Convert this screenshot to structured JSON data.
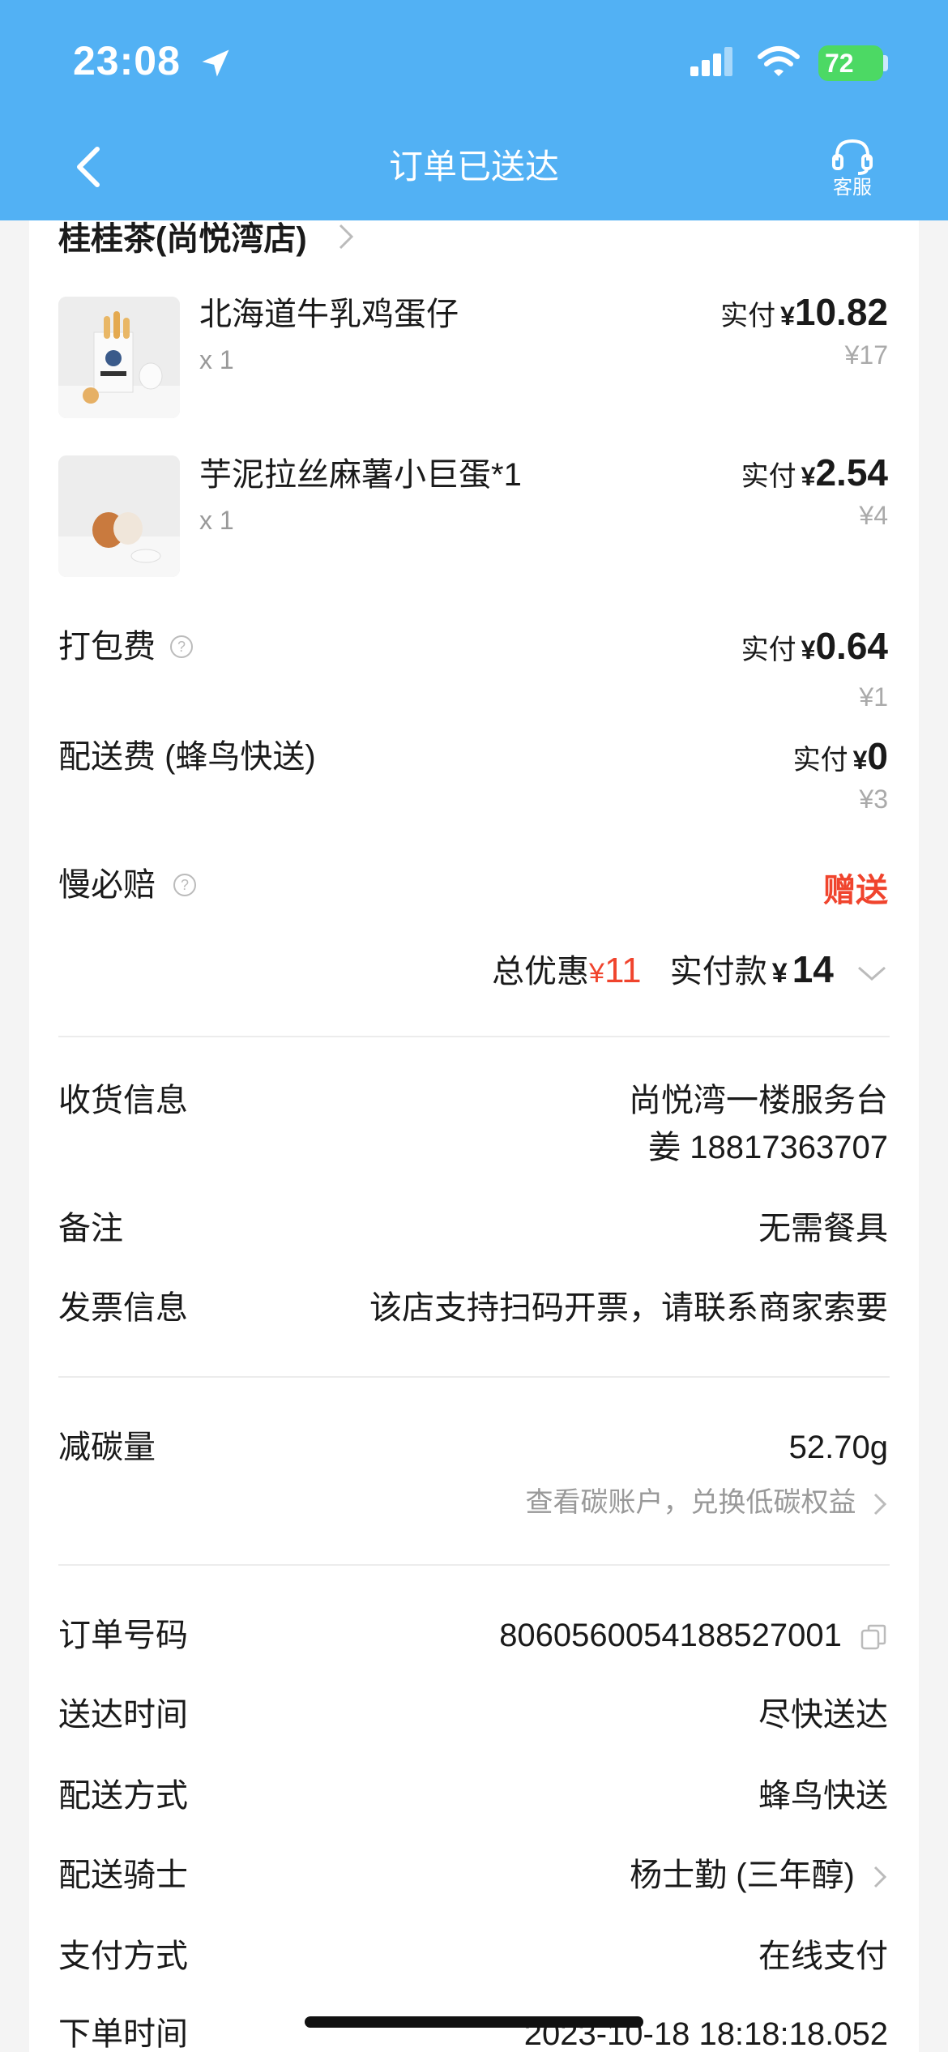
{
  "status_bar": {
    "time": "23:08",
    "battery": "72"
  },
  "header": {
    "title": "订单已送达",
    "service_label": "客服"
  },
  "shop": {
    "name": "桂桂茶(尚悦湾店)"
  },
  "items": [
    {
      "name": "北海道牛乳鸡蛋仔",
      "qty": "x 1",
      "paid_label": "实付",
      "currency": "¥",
      "paid": "10.82",
      "original": "¥17"
    },
    {
      "name": "芋泥拉丝麻薯小巨蛋*1",
      "qty": "x 1",
      "paid_label": "实付",
      "currency": "¥",
      "paid": "2.54",
      "original": "¥4"
    }
  ],
  "fees": {
    "packing": {
      "label": "打包费",
      "paid_label": "实付",
      "currency": "¥",
      "paid": "0.64",
      "original": "¥1"
    },
    "delivery": {
      "label": "配送费 (蜂鸟快送)",
      "paid_label": "实付",
      "currency": "¥",
      "paid": "0",
      "original": "¥3"
    },
    "slow_compensation": {
      "label": "慢必赔",
      "value": "赠送"
    }
  },
  "summary": {
    "discount_label": "总优惠",
    "discount_currency": "¥",
    "discount": "11",
    "paid_label": "实付款",
    "paid_currency": "¥",
    "paid": "14"
  },
  "delivery_info": {
    "receiver_label": "收货信息",
    "receiver_address": "尚悦湾一楼服务台",
    "receiver_contact": "姜 18817363707",
    "note_label": "备注",
    "note_value": "无需餐具",
    "invoice_label": "发票信息",
    "invoice_value": "该店支持扫码开票，请联系商家索要"
  },
  "carbon": {
    "label": "减碳量",
    "value": "52.70g",
    "link": "查看碳账户，兑换低碳权益"
  },
  "order": {
    "number_label": "订单号码",
    "number": "8060560054188527001",
    "arrival_label": "送达时间",
    "arrival": "尽快送达",
    "method_label": "配送方式",
    "method": "蜂鸟快送",
    "rider_label": "配送骑士",
    "rider": "杨士勤 (三年醇)",
    "payment_label": "支付方式",
    "payment": "在线支付",
    "time_label": "下单时间",
    "time": "2023-10-18 18:18:18.052"
  },
  "colors": {
    "header": "#52b1f4",
    "accent_red": "#f0442d",
    "battery": "#4cd964"
  }
}
